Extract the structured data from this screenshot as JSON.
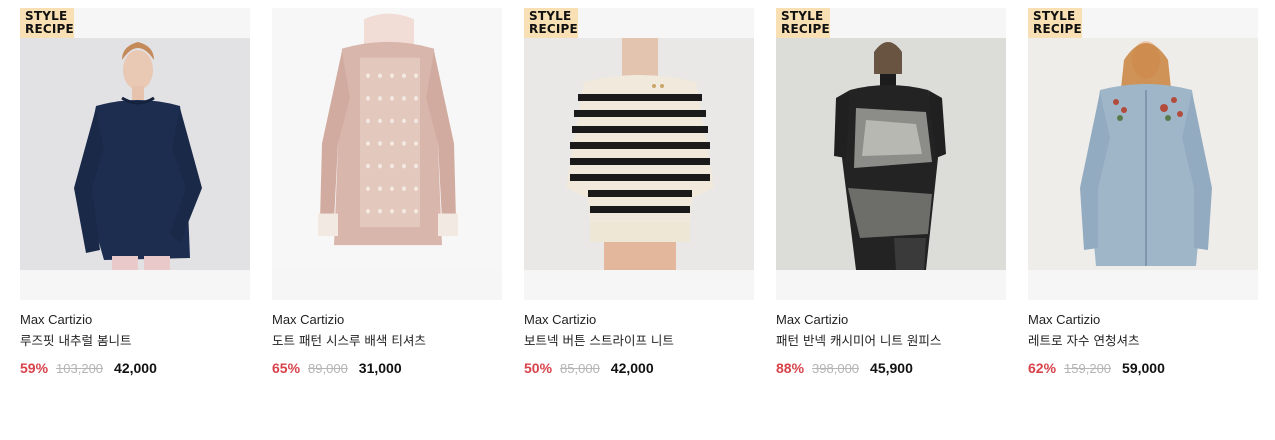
{
  "products": [
    {
      "badge": [
        "STYLE",
        "RECIPE"
      ],
      "has_badge": true,
      "image": "navy-knit-photo",
      "brand": "Max Cartizio",
      "title": "루즈핏 내추럴 봄니트",
      "discount": "59%",
      "original_price": "103,200",
      "sale_price": "42,000"
    },
    {
      "badge": [],
      "has_badge": false,
      "image": "pink-dot-top-photo",
      "brand": "Max Cartizio",
      "title": "도트 패턴 시스루 배색 티셔츠",
      "discount": "65%",
      "original_price": "89,000",
      "sale_price": "31,000"
    },
    {
      "badge": [
        "STYLE",
        "RECIPE"
      ],
      "has_badge": true,
      "image": "stripe-knit-photo",
      "brand": "Max Cartizio",
      "title": "보트넥 버튼 스트라이프 니트",
      "discount": "50%",
      "original_price": "85,000",
      "sale_price": "42,000"
    },
    {
      "badge": [
        "STYLE",
        "RECIPE"
      ],
      "has_badge": true,
      "image": "pattern-dress-photo",
      "brand": "Max Cartizio",
      "title": "패턴 반넥 캐시미어 니트 원피스",
      "discount": "88%",
      "original_price": "398,000",
      "sale_price": "45,900"
    },
    {
      "badge": [
        "STYLE",
        "RECIPE"
      ],
      "has_badge": true,
      "image": "denim-shirt-photo",
      "brand": "Max Cartizio",
      "title": "레트로 자수 연청셔츠",
      "discount": "62%",
      "original_price": "159,200",
      "sale_price": "59,000"
    }
  ],
  "colors": {
    "badge_bg": "#f8dfb4",
    "discount": "#d8434b",
    "original_price": "#b5b5b5",
    "text": "#222222"
  }
}
